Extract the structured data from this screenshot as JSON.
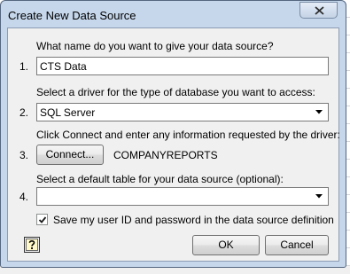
{
  "window": {
    "title": "Create New Data Source"
  },
  "steps": [
    {
      "number": "1.",
      "prompt": "What name do you want to give your data source?",
      "value": "CTS Data"
    },
    {
      "number": "2.",
      "prompt": "Select a driver for the type of database you want to access:",
      "value": "SQL Server"
    },
    {
      "number": "3.",
      "prompt": "Click Connect and enter any information requested by the driver:",
      "button_label": "Connect...",
      "connection_name": "COMPANYREPORTS"
    },
    {
      "number": "4.",
      "prompt": "Select a default table for your data source (optional):",
      "value": ""
    }
  ],
  "save_credentials": {
    "label": "Save my user ID and password in the data source definition",
    "checked": true
  },
  "buttons": {
    "ok": "OK",
    "cancel": "Cancel"
  },
  "icons": {
    "close": "close-icon",
    "help": "help-icon",
    "dropdown": "chevron-down-icon",
    "check": "checkmark-icon"
  }
}
